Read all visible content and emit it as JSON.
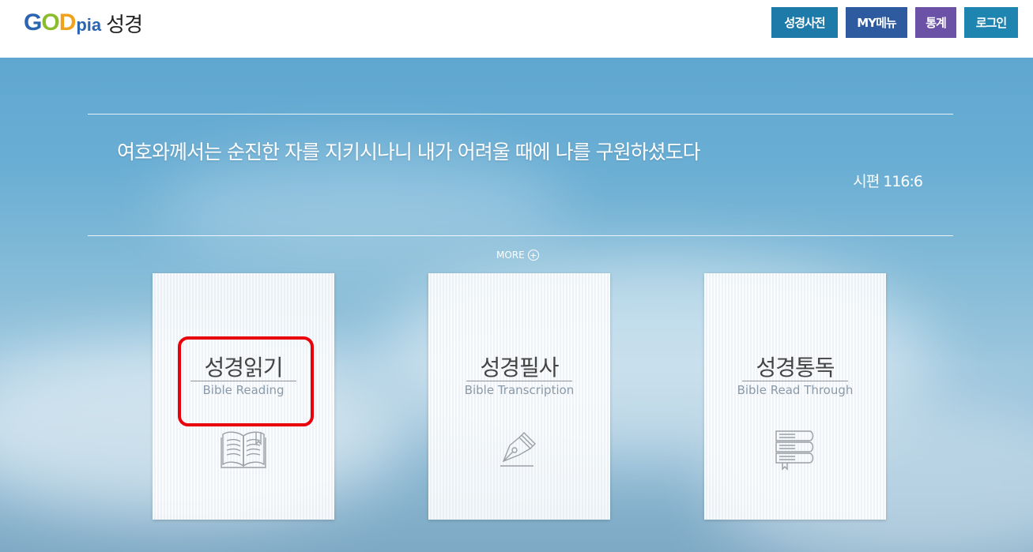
{
  "header": {
    "logo": {
      "g": "G",
      "o": "O",
      "d": "D",
      "pia": "pia",
      "kr": "성경"
    },
    "nav": {
      "dictionary": "성경사전",
      "my_menu": "MY메뉴",
      "stats": "통계",
      "login": "로그인"
    }
  },
  "hero": {
    "verse": "여호와께서는 순진한 자를 지키시나니 내가 어려울 때에 나를 구원하셨도다",
    "reference": "시편 116:6",
    "more_label": "MORE",
    "more_icon": "plus-circle-icon"
  },
  "cards": [
    {
      "title": "성경읽기",
      "subtitle": "Bible Reading",
      "icon": "open-book-icon"
    },
    {
      "title": "성경필사",
      "subtitle": "Bible Transcription",
      "icon": "fountain-pen-icon"
    },
    {
      "title": "성경통독",
      "subtitle": "Bible Read Through",
      "icon": "book-stack-icon"
    }
  ],
  "colors": {
    "nav_dictionary": "#1e7aa8",
    "nav_my_menu": "#2e5aa0",
    "nav_stats": "#6b52a6",
    "nav_login": "#1e84b0",
    "highlight": "#e8000b"
  }
}
